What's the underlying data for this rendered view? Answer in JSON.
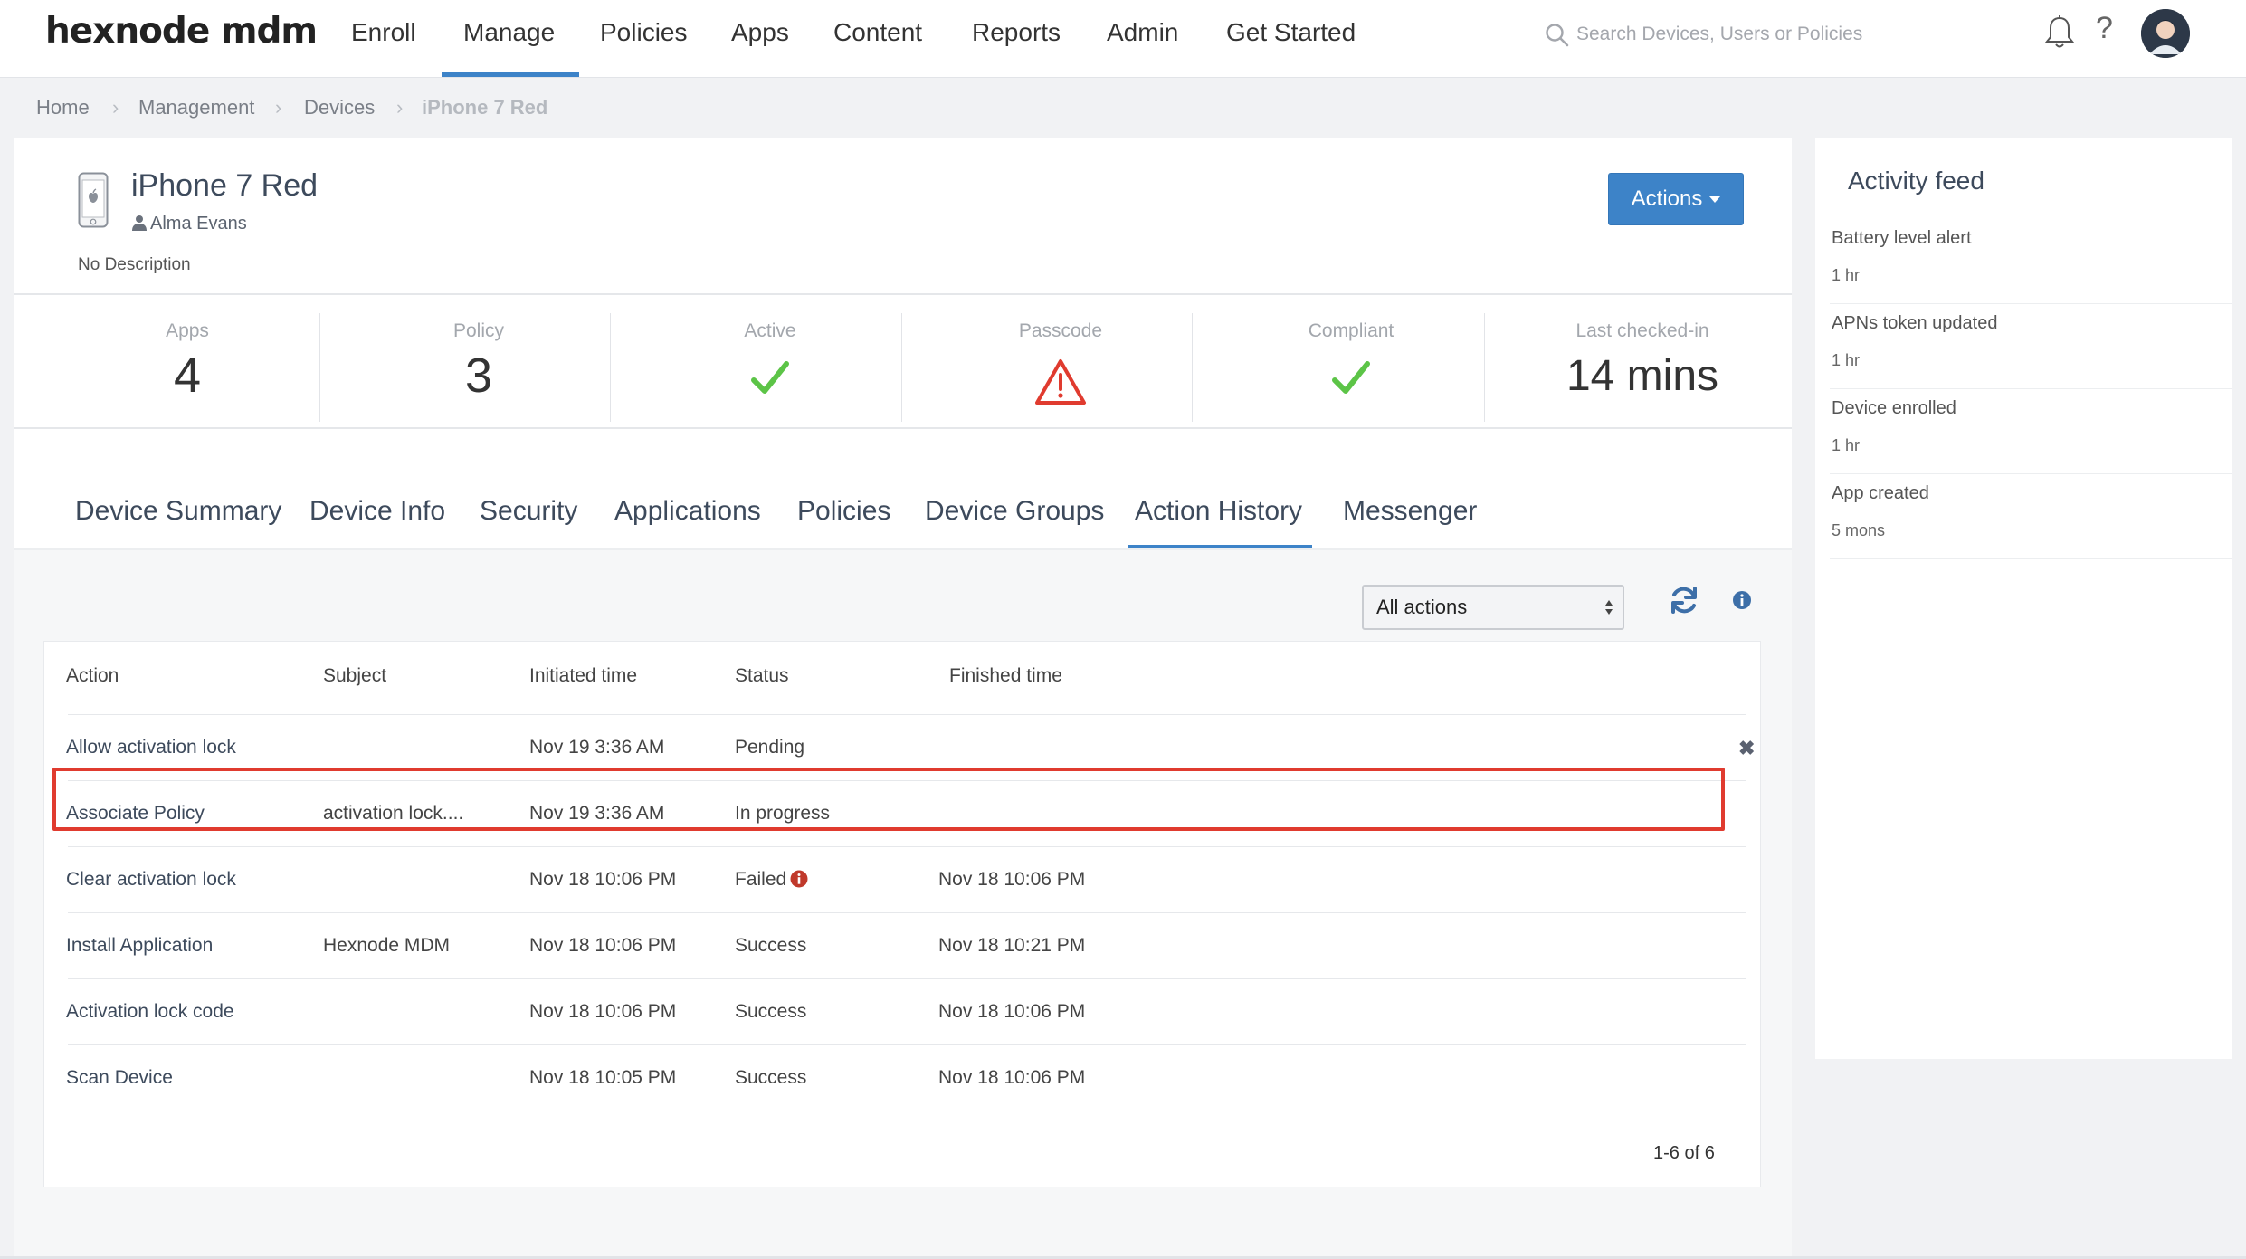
{
  "brand": {
    "logo": "hexnode mdm",
    "accent": "#3d83c8",
    "highlight": "#e03b2f"
  },
  "nav": {
    "items": [
      "Enroll",
      "Manage",
      "Policies",
      "Apps",
      "Content",
      "Reports",
      "Admin",
      "Get Started"
    ],
    "active": "Manage",
    "search_placeholder": "Search Devices, Users or Policies"
  },
  "breadcrumb": [
    "Home",
    "Management",
    "Devices",
    "iPhone 7 Red"
  ],
  "device": {
    "name": "iPhone 7 Red",
    "user": "Alma Evans",
    "description": "No Description",
    "actions_label": "Actions"
  },
  "stats": {
    "apps": {
      "label": "Apps",
      "value": "4"
    },
    "policy": {
      "label": "Policy",
      "value": "3"
    },
    "active": {
      "label": "Active",
      "icon": "check-icon"
    },
    "passcode": {
      "label": "Passcode",
      "icon": "warning-icon"
    },
    "compliant": {
      "label": "Compliant",
      "icon": "check-icon"
    },
    "last_checked": {
      "label": "Last checked-in",
      "value": "14 mins"
    }
  },
  "tabs": [
    "Device Summary",
    "Device Info",
    "Security",
    "Applications",
    "Policies",
    "Device Groups",
    "Action History",
    "Messenger"
  ],
  "active_tab": "Action History",
  "filter": {
    "selected": "All actions"
  },
  "table": {
    "headers": [
      "Action",
      "Subject",
      "Initiated time",
      "Status",
      "Finished time"
    ],
    "rows": [
      {
        "action": "Allow activation lock",
        "subject": "",
        "initiated": "Nov 19 3:36 AM",
        "status": "Pending",
        "finished": ""
      },
      {
        "action": "Associate Policy",
        "subject": "activation lock....",
        "initiated": "Nov 19 3:36 AM",
        "status": "In progress",
        "finished": ""
      },
      {
        "action": "Clear activation lock",
        "subject": "",
        "initiated": "Nov 18 10:06 PM",
        "status": "Failed",
        "finished": "Nov 18 10:06 PM"
      },
      {
        "action": "Install Application",
        "subject": "Hexnode MDM",
        "initiated": "Nov 18 10:06 PM",
        "status": "Success",
        "finished": "Nov 18 10:21 PM"
      },
      {
        "action": "Activation lock code",
        "subject": "",
        "initiated": "Nov 18 10:06 PM",
        "status": "Success",
        "finished": "Nov 18 10:06 PM"
      },
      {
        "action": "Scan Device",
        "subject": "",
        "initiated": "Nov 18 10:05 PM",
        "status": "Success",
        "finished": "Nov 18 10:06 PM"
      }
    ],
    "pagination": "1-6 of 6"
  },
  "feed": {
    "title": "Activity feed",
    "items": [
      {
        "title": "Battery level alert",
        "time": "1 hr"
      },
      {
        "title": "APNs token updated",
        "time": "1 hr"
      },
      {
        "title": "Device enrolled",
        "time": "1 hr"
      },
      {
        "title": "App created",
        "time": "5 mons"
      }
    ]
  }
}
